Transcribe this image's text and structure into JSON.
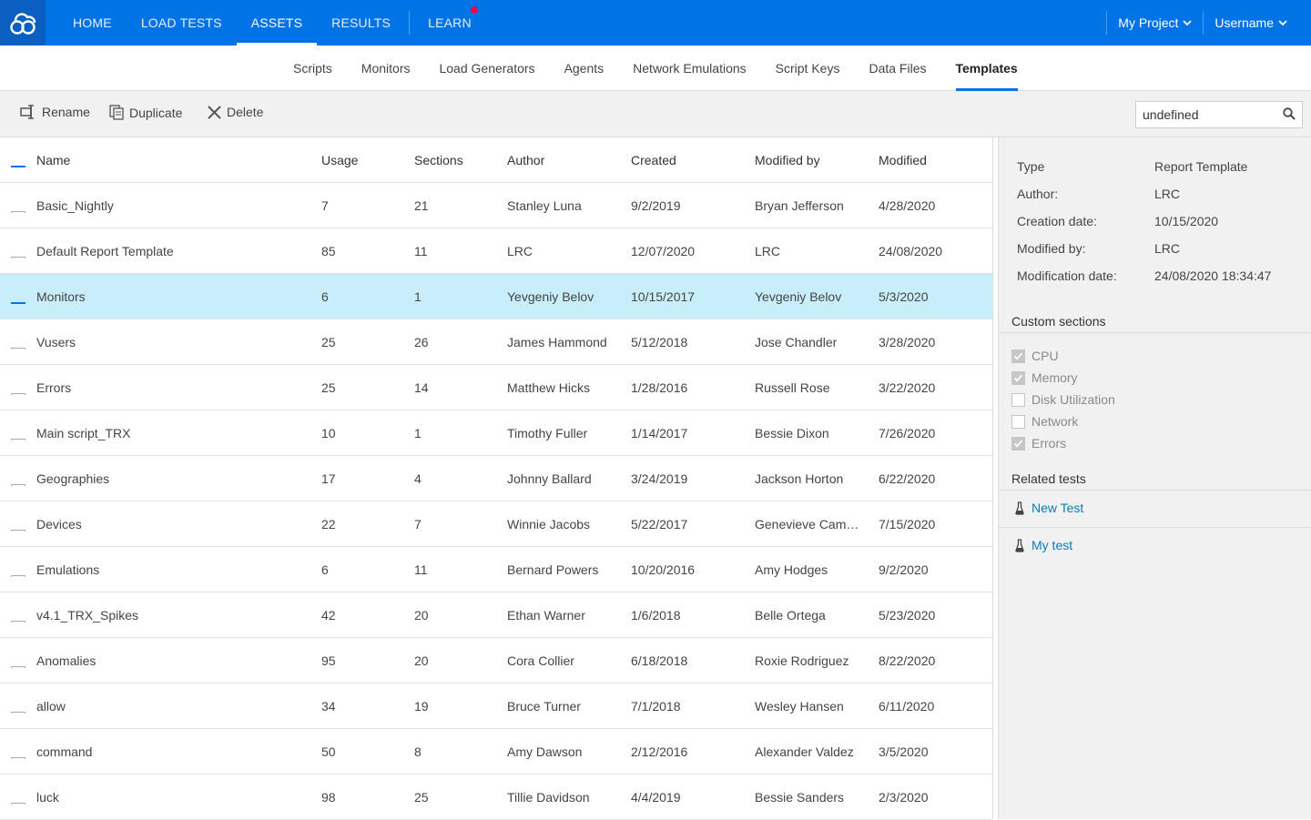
{
  "nav": {
    "items": [
      {
        "label": "HOME",
        "active": false
      },
      {
        "label": "LOAD TESTS",
        "active": false
      },
      {
        "label": "ASSETS",
        "active": true
      },
      {
        "label": "RESULTS",
        "active": false
      },
      {
        "label": "LEARN",
        "active": false,
        "has_notification": true
      }
    ],
    "project": "My Project",
    "user": "Username"
  },
  "subnav": {
    "tabs": [
      {
        "label": "Scripts"
      },
      {
        "label": "Monitors"
      },
      {
        "label": "Load Generators"
      },
      {
        "label": "Agents"
      },
      {
        "label": "Network Emulations"
      },
      {
        "label": "Script Keys"
      },
      {
        "label": "Data Files"
      },
      {
        "label": "Templates",
        "active": true
      }
    ]
  },
  "toolbar": {
    "rename": "Rename",
    "duplicate": "Duplicate",
    "delete": "Delete",
    "search_value": "undefined"
  },
  "table": {
    "headers": {
      "name": "Name",
      "usage": "Usage",
      "sections": "Sections",
      "author": "Author",
      "created": "Created",
      "modified_by": "Modified by",
      "modified": "Modified"
    },
    "rows": [
      {
        "name": "Basic_Nightly",
        "usage": "7",
        "sections": "21",
        "author": "Stanley Luna",
        "created": "9/2/2019",
        "modified_by": "Bryan Jefferson",
        "modified": "4/28/2020"
      },
      {
        "name": "Default Report Template",
        "usage": "85",
        "sections": "11",
        "author": "LRC",
        "created": "12/07/2020",
        "modified_by": "LRC",
        "modified": "24/08/2020"
      },
      {
        "name": "Monitors",
        "usage": "6",
        "sections": "1",
        "author": "Yevgeniy Belov",
        "created": "10/15/2017",
        "modified_by": "Yevgeniy Belov",
        "modified": "5/3/2020",
        "selected": true
      },
      {
        "name": "Vusers",
        "usage": "25",
        "sections": "26",
        "author": "James Hammond",
        "created": "5/12/2018",
        "modified_by": "Jose Chandler",
        "modified": "3/28/2020"
      },
      {
        "name": "Errors",
        "usage": "25",
        "sections": "14",
        "author": "Matthew Hicks",
        "created": "1/28/2016",
        "modified_by": "Russell Rose",
        "modified": "3/22/2020"
      },
      {
        "name": "Main script_TRX",
        "usage": "10",
        "sections": "1",
        "author": "Timothy Fuller",
        "created": "1/14/2017",
        "modified_by": "Bessie Dixon",
        "modified": "7/26/2020"
      },
      {
        "name": "Geographies",
        "usage": "17",
        "sections": "4",
        "author": "Johnny Ballard",
        "created": "3/24/2019",
        "modified_by": "Jackson Horton",
        "modified": "6/22/2020"
      },
      {
        "name": "Devices",
        "usage": "22",
        "sections": "7",
        "author": "Winnie Jacobs",
        "created": "5/22/2017",
        "modified_by": "Genevieve Camp...",
        "modified": "7/15/2020"
      },
      {
        "name": "Emulations",
        "usage": "6",
        "sections": "11",
        "author": "Bernard Powers",
        "created": "10/20/2016",
        "modified_by": "Amy Hodges",
        "modified": "9/2/2020"
      },
      {
        "name": "v4.1_TRX_Spikes",
        "usage": "42",
        "sections": "20",
        "author": "Ethan Warner",
        "created": "1/6/2018",
        "modified_by": "Belle Ortega",
        "modified": "5/23/2020"
      },
      {
        "name": "Anomalies",
        "usage": "95",
        "sections": "20",
        "author": "Cora Collier",
        "created": "6/18/2018",
        "modified_by": "Roxie Rodriguez",
        "modified": "8/22/2020"
      },
      {
        "name": "allow",
        "usage": "34",
        "sections": "19",
        "author": "Bruce Turner",
        "created": "7/1/2018",
        "modified_by": "Wesley Hansen",
        "modified": "6/11/2020"
      },
      {
        "name": "command",
        "usage": "50",
        "sections": "8",
        "author": "Amy Dawson",
        "created": "2/12/2016",
        "modified_by": "Alexander Valdez",
        "modified": "3/5/2020"
      },
      {
        "name": "luck",
        "usage": "98",
        "sections": "25",
        "author": "Tillie Davidson",
        "created": "4/4/2019",
        "modified_by": "Bessie Sanders",
        "modified": "2/3/2020"
      }
    ]
  },
  "details": {
    "properties": [
      {
        "label": "Type",
        "value": "Report Template"
      },
      {
        "label": "Author:",
        "value": "LRC"
      },
      {
        "label": "Creation date:",
        "value": "10/15/2020"
      },
      {
        "label": "Modified by:",
        "value": "LRC"
      },
      {
        "label": "Modification date:",
        "value": "24/08/2020 18:34:47"
      }
    ],
    "custom_sections_title": "Custom sections",
    "custom_sections": [
      {
        "label": "CPU",
        "checked": true
      },
      {
        "label": "Memory",
        "checked": true
      },
      {
        "label": "Disk Utilization",
        "checked": false
      },
      {
        "label": "Network",
        "checked": false
      },
      {
        "label": "Errors",
        "checked": true
      }
    ],
    "related_tests_title": "Related tests",
    "related_tests": [
      {
        "label": "New Test"
      },
      {
        "label": "My test"
      }
    ]
  },
  "colors": {
    "brand_blue": "#0073e7",
    "selected_row": "#c8eefc",
    "notification": "#f5004d",
    "link": "#0a7bb8"
  }
}
